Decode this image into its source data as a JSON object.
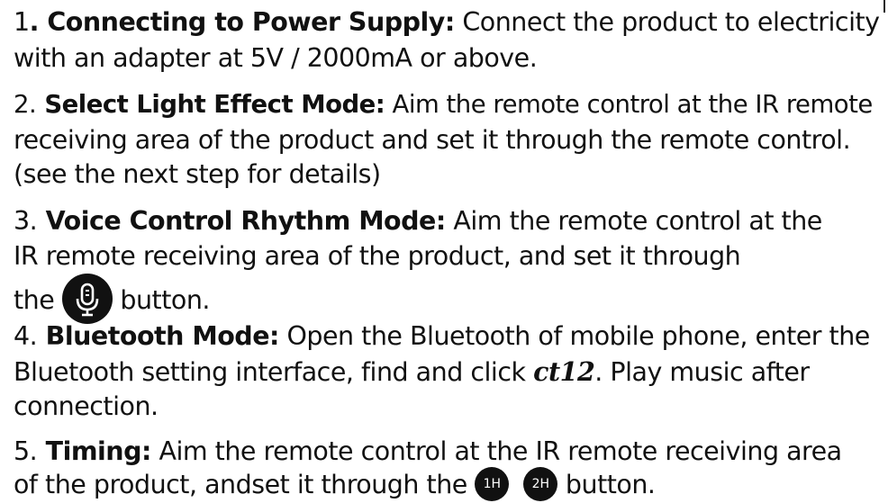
{
  "steps": [
    {
      "lines": [
        {
          "num": "1",
          "title": ". Connecting to Power Supply:",
          "text": " Connect the product to electricity"
        },
        {
          "text": "with an adapter at 5V / 2000mA or above."
        }
      ]
    },
    {
      "lines": [
        {
          "num": "2.",
          "title": " Select Light Effect Mode:",
          "text": " Aim the remote control at the IR remote"
        },
        {
          "text": " receiving area of the product and set it through the remote control."
        },
        {
          "text": "(see the next step for details)"
        }
      ]
    },
    {
      "lines": [
        {
          "num": "3.",
          "title": " Voice Control Rhythm Mode:",
          "text": " Aim the remote control at the"
        },
        {
          "text": "IR remote receiving area of the product, and set it through"
        },
        {
          "pre": "the ",
          "post": " button.",
          "icon": "microphone-icon"
        }
      ]
    },
    {
      "lines": [
        {
          "num": "4.",
          "title": " Bluetooth Mode:",
          "text": " Open the Bluetooth of mobile phone, enter the"
        },
        {
          "pre": "Bluetooth setting interface, find and click ",
          "device": "ct12",
          "post": ". Play music after"
        },
        {
          "text": "connection."
        }
      ]
    },
    {
      "lines": [
        {
          "num": "5.",
          "title": " Timing:",
          "text": " Aim the remote control at the IR remote receiving area"
        },
        {
          "pre": "of the product, andset it through the ",
          "btn1": "1H",
          "btn2": "2H",
          "post": " button."
        }
      ]
    }
  ]
}
